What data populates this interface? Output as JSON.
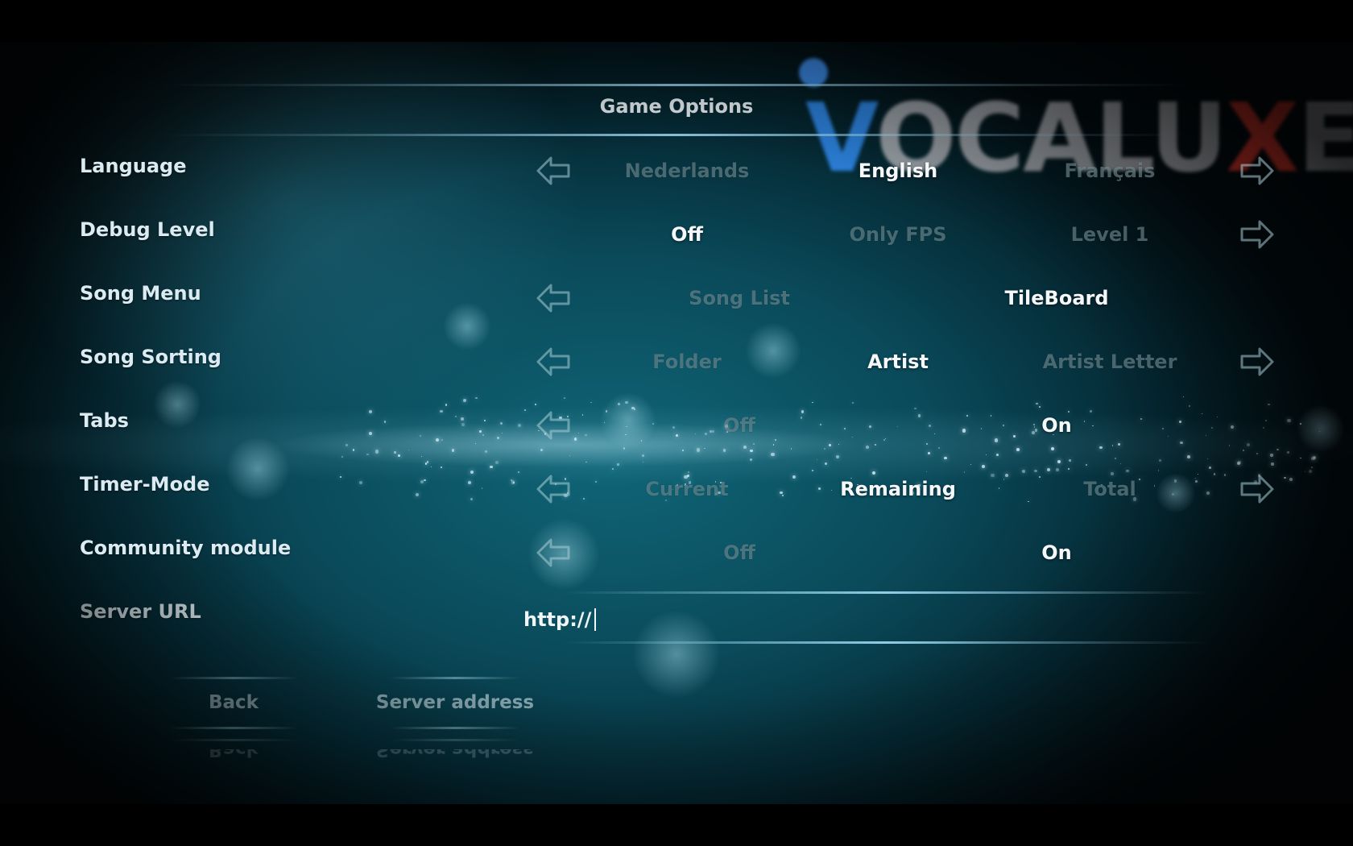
{
  "screen": {
    "title": "Game Options"
  },
  "logo": {
    "text_v": "V",
    "text_rest": "OCALU",
    "text_x": "X",
    "text_e": "E"
  },
  "options": [
    {
      "label": "Language",
      "values": [
        "Nederlands",
        "English",
        "Français"
      ],
      "selected": "English",
      "left_arrow": true,
      "right_arrow": true
    },
    {
      "label": "Debug Level",
      "values": [
        "Off",
        "Only FPS",
        "Level 1"
      ],
      "selected": "Off",
      "left_arrow": false,
      "right_arrow": true
    },
    {
      "label": "Song Menu",
      "values": [
        "Song List",
        "TileBoard"
      ],
      "selected": "TileBoard",
      "left_arrow": true,
      "right_arrow": false
    },
    {
      "label": "Song Sorting",
      "values": [
        "Folder",
        "Artist",
        "Artist Letter"
      ],
      "selected": "Artist",
      "left_arrow": true,
      "right_arrow": true
    },
    {
      "label": "Tabs",
      "values": [
        "Off",
        "On"
      ],
      "selected": "On",
      "left_arrow": true,
      "right_arrow": false
    },
    {
      "label": "Timer-Mode",
      "values": [
        "Current",
        "Remaining",
        "Total"
      ],
      "selected": "Remaining",
      "left_arrow": true,
      "right_arrow": true
    },
    {
      "label": "Community module",
      "values": [
        "Off",
        "On"
      ],
      "selected": "On",
      "left_arrow": true,
      "right_arrow": false
    }
  ],
  "server_url": {
    "label": "Server URL",
    "value": "http://"
  },
  "buttons": {
    "back": "Back",
    "server_address": "Server address"
  },
  "icons": {
    "prev": "arrow-left-icon",
    "next": "arrow-right-icon"
  },
  "colors": {
    "selected_text": "#f4f8fa",
    "unselected_text": "#a0c3cd",
    "accent_line": "#a0dcf5",
    "logo_blue": "#2b7fd8",
    "logo_red": "#d8352a"
  }
}
